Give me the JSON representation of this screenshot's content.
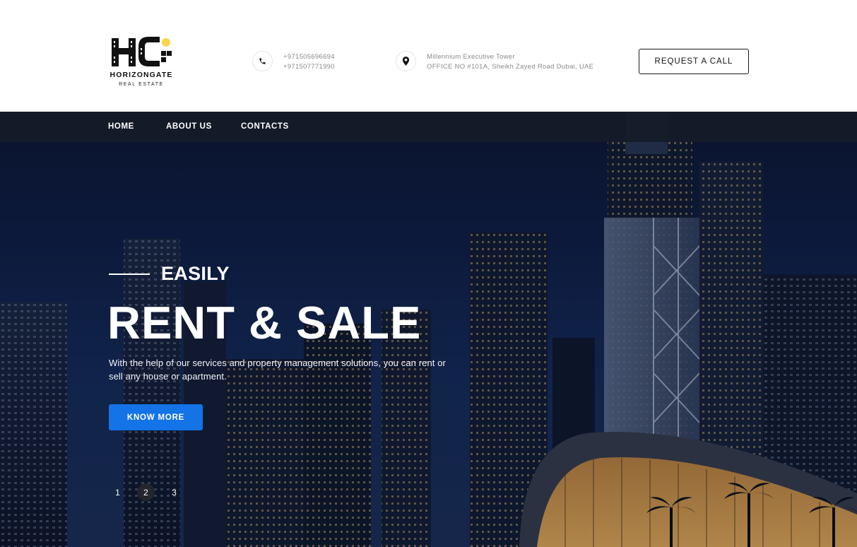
{
  "brand": {
    "name": "HORIZONGATE",
    "tagline": "REAL ESTATE",
    "accent": "#f7d64a"
  },
  "contact": {
    "phones": [
      "+971505696694",
      "+971507771990"
    ],
    "address": [
      "Millennium Executive Tower",
      "OFFICE NO #101A, Sheikh Zayed Road Dubai, UAE"
    ]
  },
  "header": {
    "cta": "REQUEST A CALL"
  },
  "nav": {
    "items": [
      "HOME",
      "ABOUT US",
      "CONTACTS"
    ]
  },
  "hero": {
    "eyebrow": "EASILY",
    "title": "RENT & SALE",
    "text": "With the help of our services and property management solutions, you can rent or sell any house or apartment.",
    "button": "KNOW MORE",
    "button_color": "#1473e6",
    "slides": [
      "1",
      "2",
      "3"
    ],
    "active_slide": "2"
  },
  "icons": {
    "phone": "phone-icon",
    "location": "map-pin-icon"
  }
}
